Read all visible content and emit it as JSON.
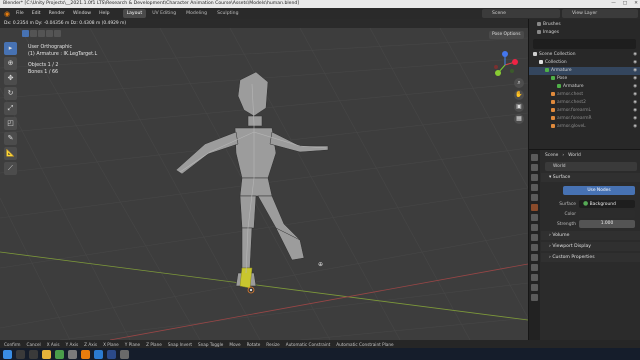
{
  "title_bar": {
    "text": "Blender* [C:\\Unity Projects\\__2021.1.0f1 LTS\\Research & Development\\Character Animation Course\\Assets\\Models\\human.blend]",
    "window_buttons": [
      "—",
      "□",
      "✕"
    ]
  },
  "top_menu": {
    "items": [
      "File",
      "Edit",
      "Render",
      "Window",
      "Help"
    ],
    "workspaces": [
      "Layout",
      "UV Editing",
      "Modeling",
      "Sculpting"
    ],
    "active_workspace": "Layout",
    "scene": "Scene",
    "view_layer": "View Layer"
  },
  "header_info": "Dx: 0.2354 m   Dy: -0.04356 m   Dz: 0.4308 m (0.4929 m)",
  "viewport": {
    "view_name": "User Orthographic",
    "context": "(1) Armature : IK.LegTarget.L",
    "objects_label": "Objects",
    "objects_value": "1 / 2",
    "bones_label": "Bones",
    "bones_value": "1 / 66",
    "mode_dropdown": "Pose Options",
    "nav_icons": [
      "zoom-icon",
      "hand-icon",
      "camera-icon",
      "grid-icon"
    ]
  },
  "toolbar_icons": [
    "select-icon",
    "cursor-icon",
    "move-icon",
    "rotate-icon",
    "scale-icon",
    "transform-icon",
    "annotate-icon",
    "measure-icon",
    "pose-tool-icon"
  ],
  "status_bar": {
    "items": [
      "Confirm",
      "Cancel",
      "X Axis",
      "Y Axis",
      "Z Axis",
      "X Plane",
      "Y Plane",
      "Z Plane",
      "Snap Invert",
      "Snap Toggle",
      "Move",
      "Rotate",
      "Resize",
      "Automatic Constraint",
      "Automatic Constraint Plane"
    ]
  },
  "outliner": {
    "top_rows": [
      {
        "label": "Brushes",
        "icon": "brush-icon"
      },
      {
        "label": "Images",
        "icon": "image-icon"
      }
    ],
    "rows": [
      {
        "label": "Scene Collection",
        "indent": 0,
        "selected": false,
        "dim": false,
        "color": "#cfcfcf"
      },
      {
        "label": "Collection",
        "indent": 1,
        "selected": false,
        "dim": false,
        "color": "#e0e0e0"
      },
      {
        "label": "Armature",
        "indent": 2,
        "selected": true,
        "dim": false,
        "color": "#4fb048"
      },
      {
        "label": "Pose",
        "indent": 3,
        "selected": false,
        "dim": false,
        "color": "#4fb048"
      },
      {
        "label": "Armature",
        "indent": 4,
        "selected": false,
        "dim": false,
        "color": "#4fb048"
      },
      {
        "label": "armor.chest",
        "indent": 3,
        "selected": false,
        "dim": true,
        "color": "#e08a3c"
      },
      {
        "label": "armor.chest2",
        "indent": 3,
        "selected": false,
        "dim": true,
        "color": "#e08a3c"
      },
      {
        "label": "armor.forearmL",
        "indent": 3,
        "selected": false,
        "dim": true,
        "color": "#e08a3c"
      },
      {
        "label": "armor.forearmR",
        "indent": 3,
        "selected": false,
        "dim": true,
        "color": "#e08a3c"
      },
      {
        "label": "armor.gloveL",
        "indent": 3,
        "selected": false,
        "dim": true,
        "color": "#e08a3c"
      }
    ]
  },
  "properties": {
    "header_scene": "Scene",
    "header_world": "World",
    "world_name": "World",
    "surface_panel": "Surface",
    "use_nodes_label": "Use Nodes",
    "surface_label": "Surface",
    "surface_value": "Background",
    "color_label": "Color",
    "strength_label": "Strength",
    "strength_value": "1.000",
    "collapsed_panels": [
      "Volume",
      "Viewport Display",
      "Custom Properties"
    ],
    "tab_icons": [
      "tool-icon",
      "render-icon",
      "output-icon",
      "view-layer-icon",
      "scene-icon",
      "world-icon",
      "object-icon",
      "modifier-icon",
      "particles-icon",
      "physics-icon",
      "constraints-icon",
      "data-icon",
      "bone-icon",
      "material-icon",
      "texture-icon"
    ],
    "active_tab": "world-icon"
  },
  "taskbar": {
    "icons": [
      "windows-icon",
      "search-icon",
      "taskview-icon",
      "explorer-icon",
      "chrome-icon",
      "unity-icon",
      "blender-icon",
      "vscode-icon",
      "photoshop-icon",
      "app-icon"
    ]
  }
}
